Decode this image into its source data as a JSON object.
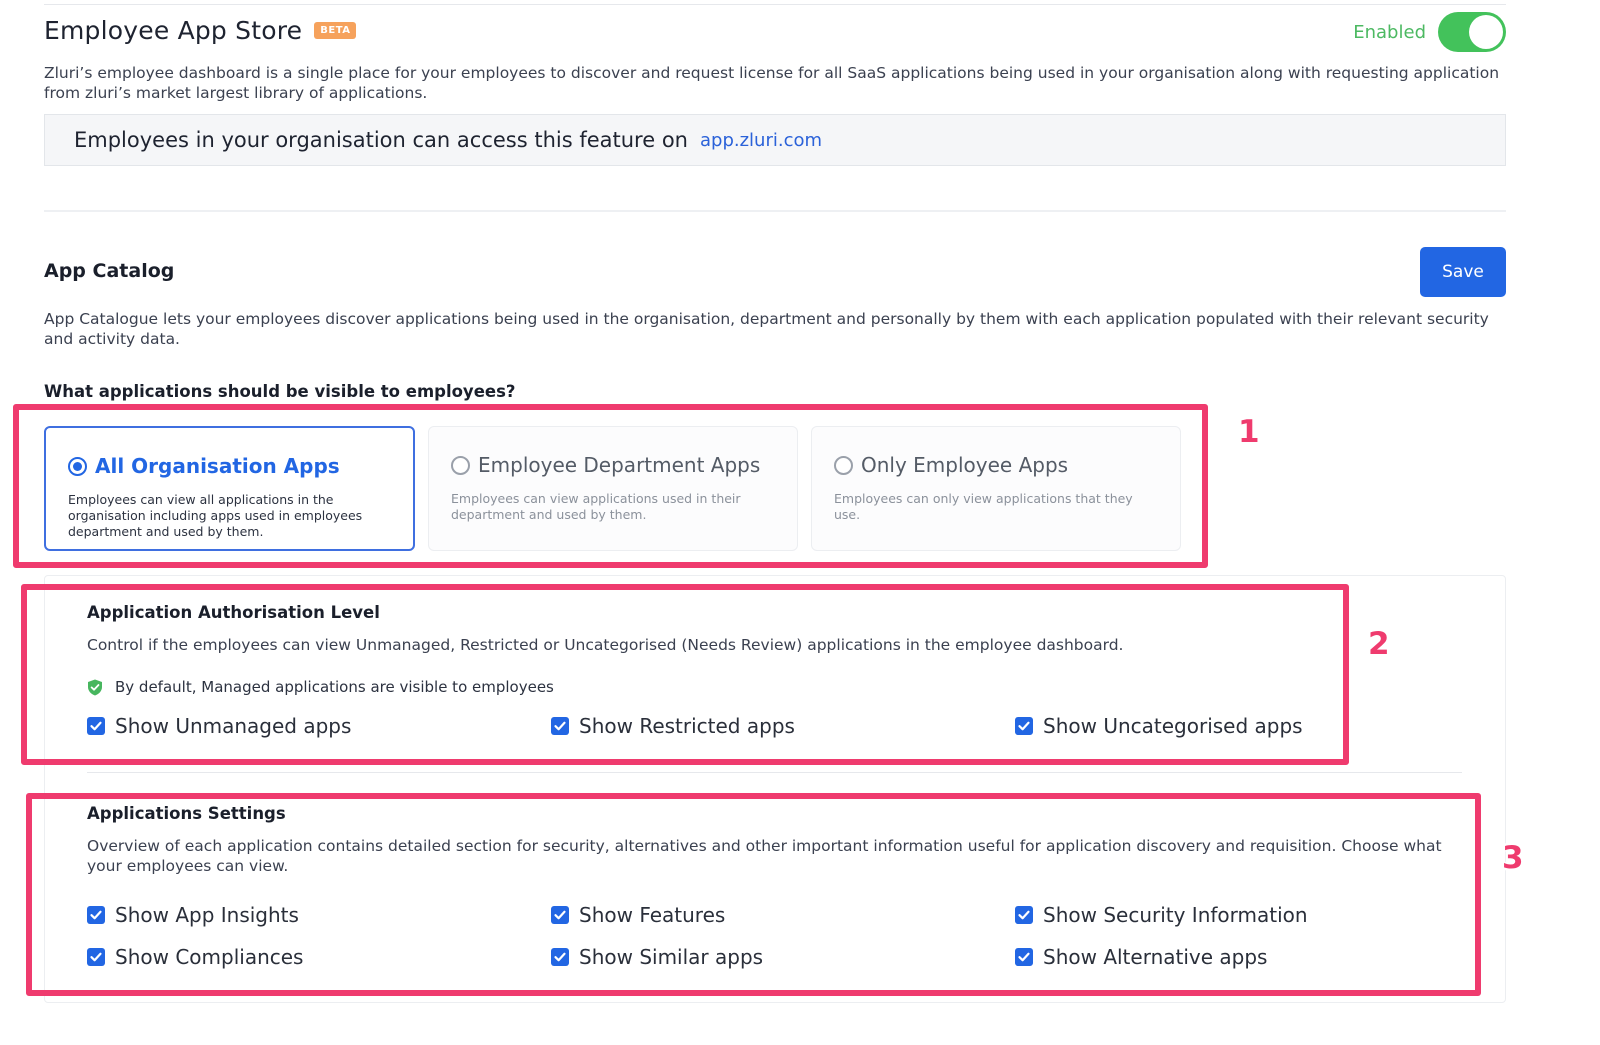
{
  "header": {
    "title": "Employee App Store",
    "badge": "BETA",
    "enabled_label": "Enabled",
    "enabled": true,
    "description": "Zluri’s employee dashboard is a single place for your employees to discover and request license for all SaaS applications being used in your organisation along with requesting application from zluri’s market largest library of applications.",
    "access_text": "Employees in your organisation can access this feature on",
    "access_link": "app.zluri.com"
  },
  "catalog": {
    "title": "App Catalog",
    "save_label": "Save",
    "description": "App Catalogue lets your employees discover applications being used in the organisation, department and personally by them with each application populated with their relevant security and activity data.",
    "question": "What applications should be visible to employees?",
    "options": [
      {
        "label": "All Organisation Apps",
        "description": "Employees can view all applications in the organisation including apps used in employees department and used by them.",
        "selected": true
      },
      {
        "label": "Employee Department Apps",
        "description": "Employees can view applications used in their department and used by them.",
        "selected": false
      },
      {
        "label": "Only Employee Apps",
        "description": "Employees can only view applications that they use.",
        "selected": false
      }
    ]
  },
  "authorisation": {
    "title": "Application Authorisation Level",
    "description": "Control if the employees can view Unmanaged, Restricted or Uncategorised (Needs Review) applications in the employee dashboard.",
    "note": "By default, Managed applications are visible to employees",
    "checks": [
      {
        "label": "Show Unmanaged apps",
        "checked": true
      },
      {
        "label": "Show Restricted apps",
        "checked": true
      },
      {
        "label": "Show Uncategorised apps",
        "checked": true
      }
    ]
  },
  "settings": {
    "title": "Applications Settings",
    "description": "Overview of each application contains detailed section for security, alternatives and other important information useful for application discovery and requisition. Choose what your employees can view.",
    "checks": [
      {
        "label": "Show App Insights",
        "checked": true
      },
      {
        "label": "Show Features",
        "checked": true
      },
      {
        "label": "Show Security Information",
        "checked": true
      },
      {
        "label": "Show Compliances",
        "checked": true
      },
      {
        "label": "Show Similar apps",
        "checked": true
      },
      {
        "label": "Show Alternative apps",
        "checked": true
      }
    ]
  },
  "annotations": [
    "1",
    "2",
    "3"
  ],
  "colors": {
    "accent": "#2266e3",
    "toggle_on": "#43c25b",
    "highlight": "#ef3b6e",
    "badge": "#f6a25c"
  }
}
